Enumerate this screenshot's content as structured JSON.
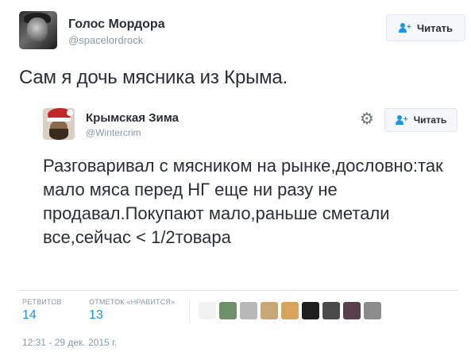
{
  "tweet": {
    "author_name": "Голос Мордора",
    "author_handle": "@spacelordrock",
    "follow_label": "Читать",
    "text": "Сам я дочь мясника из Крыма."
  },
  "quoted": {
    "author_name": "Крымская Зима",
    "author_handle": "@Wintercrim",
    "follow_label": "Читать",
    "text": "Разговаривал с мясником на рынке,дословно:так мало мяса перед НГ еще ни разу не продавал.Покупают мало,раньше сметали все,сейчас < 1/2товара"
  },
  "stats": {
    "retweets_label": "РЕТВИТОВ",
    "retweets_value": "14",
    "likes_label": "ОТМЕТОК «НРАВИТСЯ»",
    "likes_value": "13"
  },
  "likers": [
    {
      "name": "liker-1",
      "color": "#f2f2f2"
    },
    {
      "name": "liker-2",
      "color": "#6e8f6a"
    },
    {
      "name": "liker-3",
      "color": "#b8b8b8"
    },
    {
      "name": "liker-4",
      "color": "#c9a877"
    },
    {
      "name": "liker-5",
      "color": "#d9a25a"
    },
    {
      "name": "liker-6",
      "color": "#1e1e1e"
    },
    {
      "name": "liker-7",
      "color": "#4a4a4a"
    },
    {
      "name": "liker-8",
      "color": "#5a3f4f"
    },
    {
      "name": "liker-9",
      "color": "#8c8c8c"
    }
  ],
  "timestamp": "12:31 - 29 дек. 2015 г.",
  "colors": {
    "accent": "#1b95e0",
    "muted": "#8899a6",
    "text": "#292f33"
  }
}
